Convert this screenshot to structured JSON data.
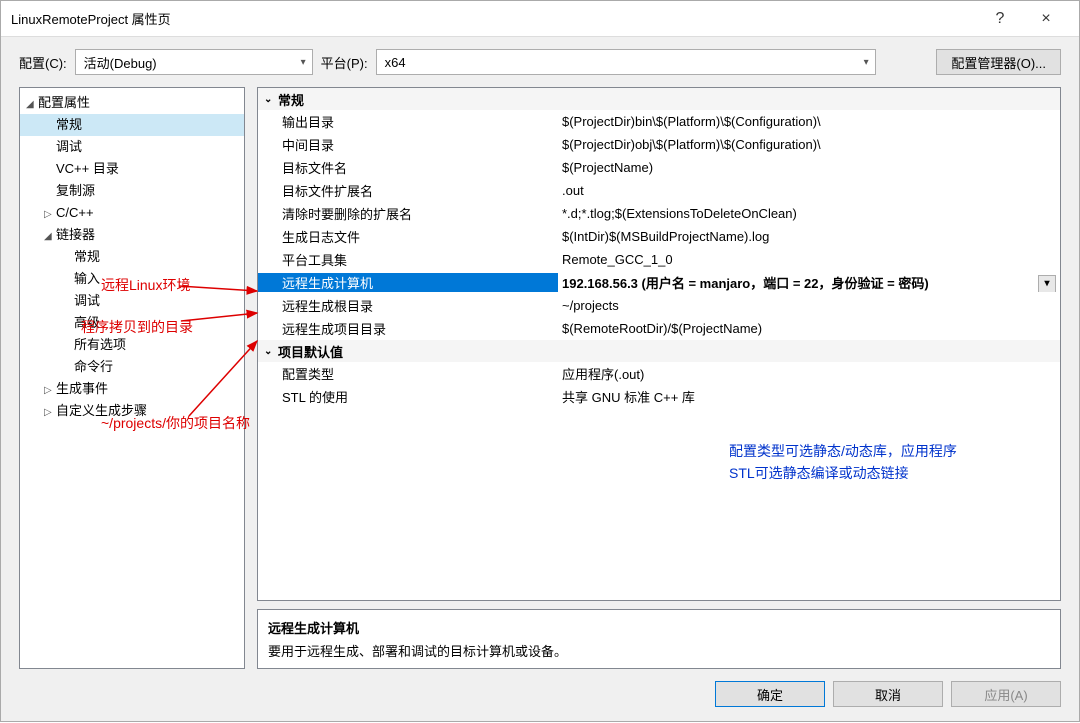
{
  "window": {
    "title": "LinuxRemoteProject 属性页",
    "help": "?",
    "close": "×"
  },
  "toolbar": {
    "config_label": "配置(C):",
    "config_value": "活动(Debug)",
    "platform_label": "平台(P):",
    "platform_value": "x64",
    "manager_btn": "配置管理器(O)..."
  },
  "tree": [
    {
      "label": "配置属性",
      "depth": 0,
      "expander": "◢"
    },
    {
      "label": "常规",
      "depth": 1,
      "selected": true
    },
    {
      "label": "调试",
      "depth": 1
    },
    {
      "label": "VC++ 目录",
      "depth": 1
    },
    {
      "label": "复制源",
      "depth": 1
    },
    {
      "label": "C/C++",
      "depth": 1,
      "expander": "▷"
    },
    {
      "label": "链接器",
      "depth": 1,
      "expander": "◢"
    },
    {
      "label": "常规",
      "depth": 2
    },
    {
      "label": "输入",
      "depth": 2
    },
    {
      "label": "调试",
      "depth": 2
    },
    {
      "label": "高级",
      "depth": 2
    },
    {
      "label": "所有选项",
      "depth": 2
    },
    {
      "label": "命令行",
      "depth": 2
    },
    {
      "label": "生成事件",
      "depth": 1,
      "expander": "▷"
    },
    {
      "label": "自定义生成步骤",
      "depth": 1,
      "expander": "▷"
    }
  ],
  "propgrid": {
    "sections": [
      {
        "label": "常规",
        "rows": [
          {
            "name": "输出目录",
            "value": "$(ProjectDir)bin\\$(Platform)\\$(Configuration)\\"
          },
          {
            "name": "中间目录",
            "value": "$(ProjectDir)obj\\$(Platform)\\$(Configuration)\\"
          },
          {
            "name": "目标文件名",
            "value": "$(ProjectName)"
          },
          {
            "name": "目标文件扩展名",
            "value": ".out"
          },
          {
            "name": "清除时要删除的扩展名",
            "value": "*.d;*.tlog;$(ExtensionsToDeleteOnClean)"
          },
          {
            "name": "生成日志文件",
            "value": "$(IntDir)$(MSBuildProjectName).log"
          },
          {
            "name": "平台工具集",
            "value": "Remote_GCC_1_0"
          },
          {
            "name": "远程生成计算机",
            "value": "192.168.56.3 (用户名 = manjaro，端口 = 22，身份验证 = 密码)",
            "selected": true,
            "dropdown": true
          },
          {
            "name": "远程生成根目录",
            "value": "~/projects"
          },
          {
            "name": "远程生成项目目录",
            "value": "$(RemoteRootDir)/$(ProjectName)"
          }
        ]
      },
      {
        "label": "项目默认值",
        "rows": [
          {
            "name": "配置类型",
            "value": "应用程序(.out)"
          },
          {
            "name": "STL 的使用",
            "value": "共享 GNU 标准 C++ 库"
          }
        ]
      }
    ]
  },
  "descbox": {
    "title": "远程生成计算机",
    "text": "要用于远程生成、部署和调试的目标计算机或设备。"
  },
  "buttons": {
    "ok": "确定",
    "cancel": "取消",
    "apply": "应用(A)"
  },
  "annotations": {
    "a1": "远程Linux环境",
    "a2": "程序拷贝到的目录",
    "a3": "~/projects/你的项目名称",
    "b1": "配置类型可选静态/动态库，应用程序",
    "b2": "STL可选静态编译或动态链接"
  }
}
